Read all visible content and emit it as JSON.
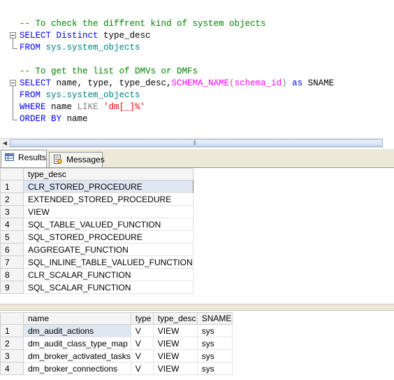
{
  "editor": {
    "line1_comment": "-- To check the diffrent kind of system objects",
    "line2": {
      "kw_select": "SELECT",
      "kw_distinct": "Distinct",
      "rest": " type_desc"
    },
    "line3": {
      "kw_from": "FROM",
      "object": " sys.system_objects"
    },
    "line5_comment": "-- To get the list of DMVs or DMFs",
    "line6": {
      "kw_select": "SELECT",
      "part1": " name, type, type_desc,",
      "fn": "SCHEMA_NAME",
      "paren_open": "(",
      "arg": "schema_id",
      "paren_close": ")",
      "kw_as": " as",
      "alias": " SNAME"
    },
    "line7": {
      "kw_from": "FROM",
      "object": " sys.system_objects"
    },
    "line8": {
      "kw_where": "WHERE",
      "col": " name",
      "kw_like": " LIKE",
      "str": " 'dm[_]%'"
    },
    "line9": {
      "kw_order": "ORDER BY",
      "col": " name"
    }
  },
  "tabs": [
    {
      "label": "Results",
      "icon": "grid-icon",
      "active": true
    },
    {
      "label": "Messages",
      "icon": "messages-icon",
      "active": false
    }
  ],
  "result1": {
    "columns": [
      "type_desc"
    ],
    "rows": [
      {
        "num": "1",
        "type_desc": "CLR_STORED_PROCEDURE"
      },
      {
        "num": "2",
        "type_desc": "EXTENDED_STORED_PROCEDURE"
      },
      {
        "num": "3",
        "type_desc": "VIEW"
      },
      {
        "num": "4",
        "type_desc": "SQL_TABLE_VALUED_FUNCTION"
      },
      {
        "num": "5",
        "type_desc": "SQL_STORED_PROCEDURE"
      },
      {
        "num": "6",
        "type_desc": "AGGREGATE_FUNCTION"
      },
      {
        "num": "7",
        "type_desc": "SQL_INLINE_TABLE_VALUED_FUNCTION"
      },
      {
        "num": "8",
        "type_desc": "CLR_SCALAR_FUNCTION"
      },
      {
        "num": "9",
        "type_desc": "SQL_SCALAR_FUNCTION"
      }
    ]
  },
  "result2": {
    "columns": [
      "name",
      "type",
      "type_desc",
      "SNAME"
    ],
    "rows": [
      {
        "num": "1",
        "name": "dm_audit_actions",
        "type": "V",
        "type_desc": "VIEW",
        "sname": "sys"
      },
      {
        "num": "2",
        "name": "dm_audit_class_type_map",
        "type": "V",
        "type_desc": "VIEW",
        "sname": "sys"
      },
      {
        "num": "3",
        "name": "dm_broker_activated_tasks",
        "type": "V",
        "type_desc": "VIEW",
        "sname": "sys"
      },
      {
        "num": "4",
        "name": "dm_broker_connections",
        "type": "V",
        "type_desc": "VIEW",
        "sname": "sys"
      }
    ]
  }
}
